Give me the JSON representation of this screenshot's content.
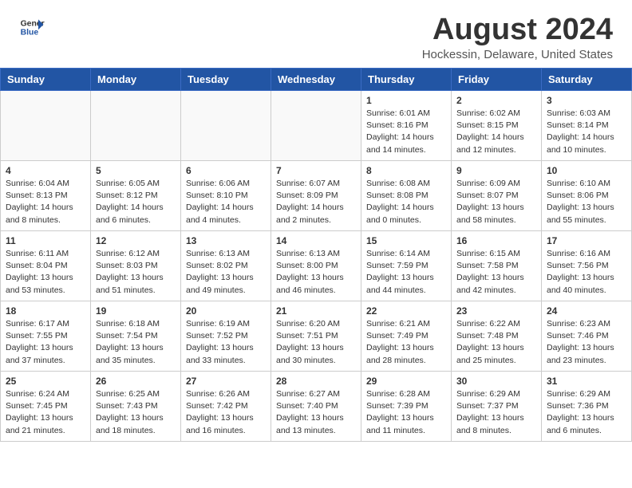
{
  "header": {
    "logo_line1": "General",
    "logo_line2": "Blue",
    "month_year": "August 2024",
    "location": "Hockessin, Delaware, United States"
  },
  "weekdays": [
    "Sunday",
    "Monday",
    "Tuesday",
    "Wednesday",
    "Thursday",
    "Friday",
    "Saturday"
  ],
  "weeks": [
    [
      {
        "day": "",
        "info": ""
      },
      {
        "day": "",
        "info": ""
      },
      {
        "day": "",
        "info": ""
      },
      {
        "day": "",
        "info": ""
      },
      {
        "day": "1",
        "info": "Sunrise: 6:01 AM\nSunset: 8:16 PM\nDaylight: 14 hours\nand 14 minutes."
      },
      {
        "day": "2",
        "info": "Sunrise: 6:02 AM\nSunset: 8:15 PM\nDaylight: 14 hours\nand 12 minutes."
      },
      {
        "day": "3",
        "info": "Sunrise: 6:03 AM\nSunset: 8:14 PM\nDaylight: 14 hours\nand 10 minutes."
      }
    ],
    [
      {
        "day": "4",
        "info": "Sunrise: 6:04 AM\nSunset: 8:13 PM\nDaylight: 14 hours\nand 8 minutes."
      },
      {
        "day": "5",
        "info": "Sunrise: 6:05 AM\nSunset: 8:12 PM\nDaylight: 14 hours\nand 6 minutes."
      },
      {
        "day": "6",
        "info": "Sunrise: 6:06 AM\nSunset: 8:10 PM\nDaylight: 14 hours\nand 4 minutes."
      },
      {
        "day": "7",
        "info": "Sunrise: 6:07 AM\nSunset: 8:09 PM\nDaylight: 14 hours\nand 2 minutes."
      },
      {
        "day": "8",
        "info": "Sunrise: 6:08 AM\nSunset: 8:08 PM\nDaylight: 14 hours\nand 0 minutes."
      },
      {
        "day": "9",
        "info": "Sunrise: 6:09 AM\nSunset: 8:07 PM\nDaylight: 13 hours\nand 58 minutes."
      },
      {
        "day": "10",
        "info": "Sunrise: 6:10 AM\nSunset: 8:06 PM\nDaylight: 13 hours\nand 55 minutes."
      }
    ],
    [
      {
        "day": "11",
        "info": "Sunrise: 6:11 AM\nSunset: 8:04 PM\nDaylight: 13 hours\nand 53 minutes."
      },
      {
        "day": "12",
        "info": "Sunrise: 6:12 AM\nSunset: 8:03 PM\nDaylight: 13 hours\nand 51 minutes."
      },
      {
        "day": "13",
        "info": "Sunrise: 6:13 AM\nSunset: 8:02 PM\nDaylight: 13 hours\nand 49 minutes."
      },
      {
        "day": "14",
        "info": "Sunrise: 6:13 AM\nSunset: 8:00 PM\nDaylight: 13 hours\nand 46 minutes."
      },
      {
        "day": "15",
        "info": "Sunrise: 6:14 AM\nSunset: 7:59 PM\nDaylight: 13 hours\nand 44 minutes."
      },
      {
        "day": "16",
        "info": "Sunrise: 6:15 AM\nSunset: 7:58 PM\nDaylight: 13 hours\nand 42 minutes."
      },
      {
        "day": "17",
        "info": "Sunrise: 6:16 AM\nSunset: 7:56 PM\nDaylight: 13 hours\nand 40 minutes."
      }
    ],
    [
      {
        "day": "18",
        "info": "Sunrise: 6:17 AM\nSunset: 7:55 PM\nDaylight: 13 hours\nand 37 minutes."
      },
      {
        "day": "19",
        "info": "Sunrise: 6:18 AM\nSunset: 7:54 PM\nDaylight: 13 hours\nand 35 minutes."
      },
      {
        "day": "20",
        "info": "Sunrise: 6:19 AM\nSunset: 7:52 PM\nDaylight: 13 hours\nand 33 minutes."
      },
      {
        "day": "21",
        "info": "Sunrise: 6:20 AM\nSunset: 7:51 PM\nDaylight: 13 hours\nand 30 minutes."
      },
      {
        "day": "22",
        "info": "Sunrise: 6:21 AM\nSunset: 7:49 PM\nDaylight: 13 hours\nand 28 minutes."
      },
      {
        "day": "23",
        "info": "Sunrise: 6:22 AM\nSunset: 7:48 PM\nDaylight: 13 hours\nand 25 minutes."
      },
      {
        "day": "24",
        "info": "Sunrise: 6:23 AM\nSunset: 7:46 PM\nDaylight: 13 hours\nand 23 minutes."
      }
    ],
    [
      {
        "day": "25",
        "info": "Sunrise: 6:24 AM\nSunset: 7:45 PM\nDaylight: 13 hours\nand 21 minutes."
      },
      {
        "day": "26",
        "info": "Sunrise: 6:25 AM\nSunset: 7:43 PM\nDaylight: 13 hours\nand 18 minutes."
      },
      {
        "day": "27",
        "info": "Sunrise: 6:26 AM\nSunset: 7:42 PM\nDaylight: 13 hours\nand 16 minutes."
      },
      {
        "day": "28",
        "info": "Sunrise: 6:27 AM\nSunset: 7:40 PM\nDaylight: 13 hours\nand 13 minutes."
      },
      {
        "day": "29",
        "info": "Sunrise: 6:28 AM\nSunset: 7:39 PM\nDaylight: 13 hours\nand 11 minutes."
      },
      {
        "day": "30",
        "info": "Sunrise: 6:29 AM\nSunset: 7:37 PM\nDaylight: 13 hours\nand 8 minutes."
      },
      {
        "day": "31",
        "info": "Sunrise: 6:29 AM\nSunset: 7:36 PM\nDaylight: 13 hours\nand 6 minutes."
      }
    ]
  ]
}
